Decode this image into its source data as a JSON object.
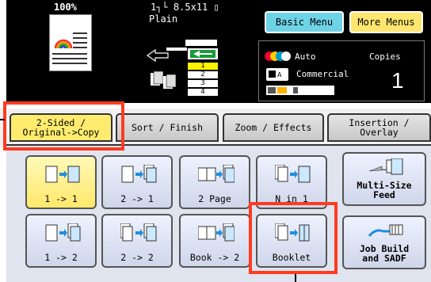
{
  "status": {
    "zoom": "100%",
    "paper_size": "1┐└ 8.5x11 ▯",
    "paper_type": "Plain",
    "color_mode": "Auto",
    "copies_label": "Copies",
    "original_mode": "Commercial",
    "copies": "1",
    "tray_numbers": [
      "1",
      "2",
      "3",
      "4"
    ],
    "selected_tray": "1"
  },
  "menu": {
    "basic_label": "Basic Menu",
    "more_label": "More Menus"
  },
  "tabs": [
    {
      "label": "2-Sided /\nOriginal->Copy",
      "active": true
    },
    {
      "label": "Sort / Finish",
      "active": false
    },
    {
      "label": "Zoom / Effects",
      "active": false
    },
    {
      "label": "Insertion /\nOverlay",
      "active": false
    }
  ],
  "options": [
    {
      "label": "1 -> 1",
      "selected": true
    },
    {
      "label": "2 -> 1",
      "selected": false
    },
    {
      "label": "2 Page",
      "selected": false
    },
    {
      "label": "N in 1",
      "selected": false
    },
    {
      "label": "1 -> 2",
      "selected": false
    },
    {
      "label": "2 -> 2",
      "selected": false
    },
    {
      "label": "Book -> 2",
      "selected": false
    },
    {
      "label": "Booklet",
      "selected": false
    }
  ],
  "side_buttons": {
    "multi_size": "Multi-Size\nFeed",
    "job_build": "Job Build\nand SADF"
  },
  "colors": {
    "selected": "#ffe86a",
    "basic_menu": "#6fd3e6",
    "more_menus": "#ffe66e",
    "highlight": "#ff3b1f"
  }
}
